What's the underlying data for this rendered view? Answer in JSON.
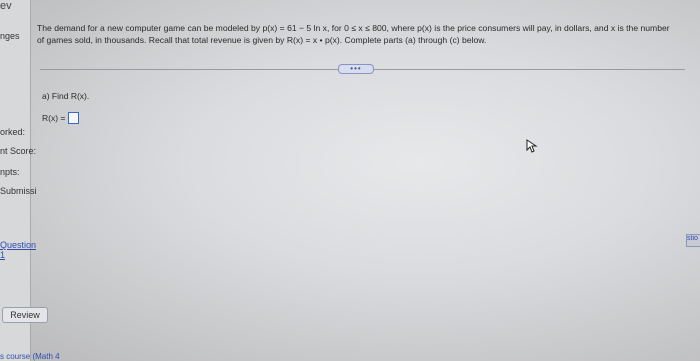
{
  "sidebar": {
    "top_label": "ev",
    "changes_label": "nges",
    "worked_label": "orked:",
    "score_label": "nt Score:",
    "attempts_label": "npts:",
    "submissions_label": "Submissi",
    "question_link": "Question 1",
    "review_button": "Review",
    "course_link": "s course (Math 4"
  },
  "problem": {
    "statement": "The demand for a new computer game can be modeled by p(x) = 61 − 5 ln x, for 0 ≤ x ≤ 800, where p(x) is the price consumers will pay, in dollars, and x is the number of games sold, in thousands. Recall that total revenue is given by R(x) = x • p(x). Complete parts (a) through (c) below.",
    "more_button": "•••",
    "part_a": "a) Find R(x).",
    "answer_prefix": "R(x) ="
  },
  "right_edge": {
    "tab_label": "stio"
  }
}
